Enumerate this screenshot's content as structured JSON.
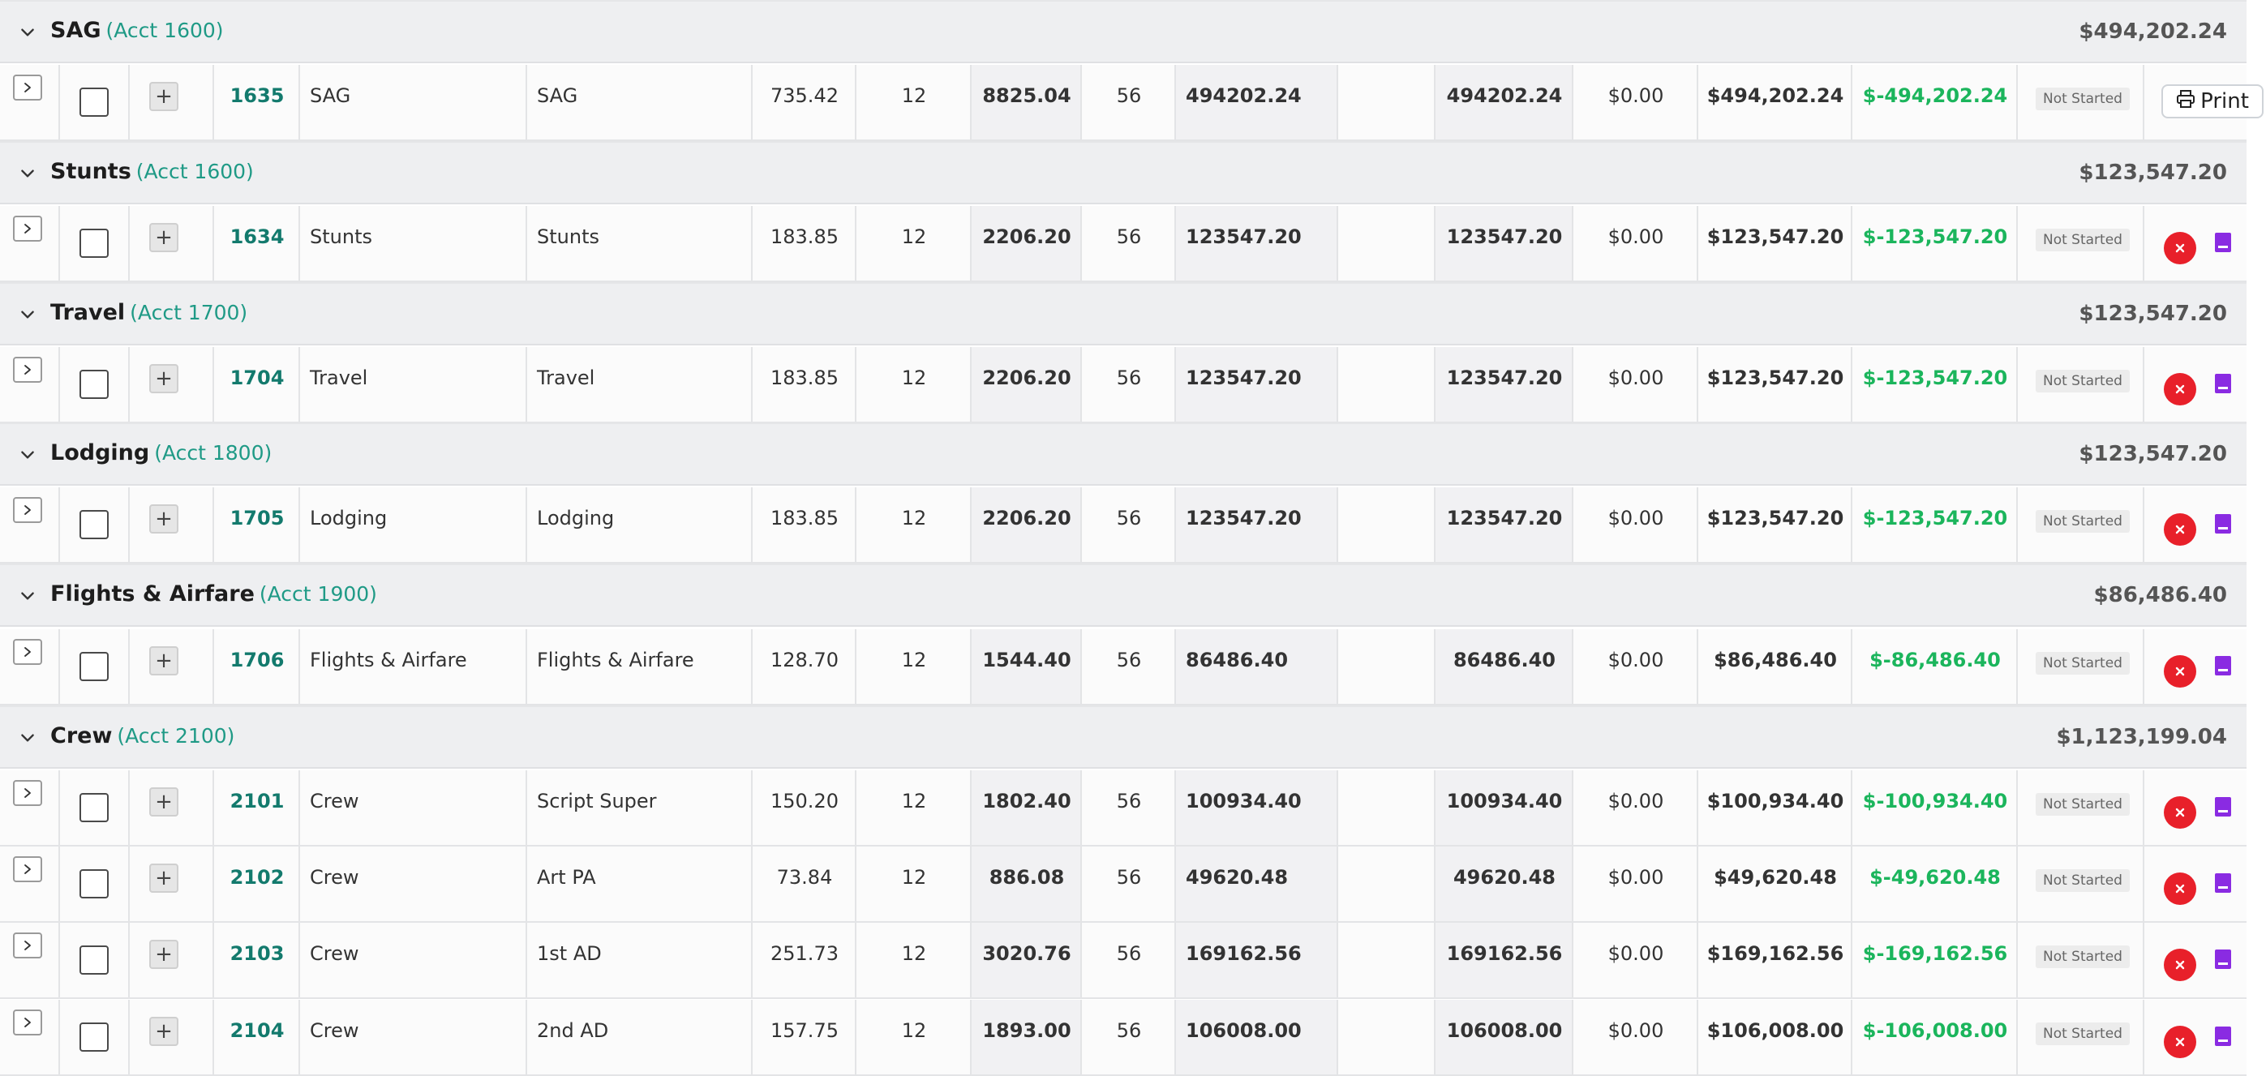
{
  "colors": {
    "accent_teal": "#1f9a86",
    "account_link": "#137a6d",
    "variance_green": "#1bb55c",
    "delete_red": "#e8202a",
    "note_purple": "#8a2be2",
    "group_bg": "#eeeff1"
  },
  "icons": {
    "group_toggle": "chevron-down-icon",
    "row_expand": "chevron-right-icon",
    "add": "plus-icon",
    "delete": "close-icon",
    "note": "note-icon",
    "print": "printer-icon"
  },
  "print_button": {
    "label": "Print"
  },
  "groups": [
    {
      "title": "SAG",
      "acct": "(Acct 1600)",
      "total": "$494,202.24",
      "rows": [
        {
          "acct": "1635",
          "category": "SAG",
          "description": "SAG",
          "rate": "735.42",
          "units": "12",
          "subtotal": "8825.04",
          "qty": "56",
          "total": "494202.24",
          "fringe": "",
          "estimate": "494202.24",
          "actual": "$0.00",
          "budget": "$494,202.24",
          "variance": "$-494,202.24",
          "status": "Not Started",
          "print": true
        }
      ]
    },
    {
      "title": "Stunts",
      "acct": "(Acct 1600)",
      "total": "$123,547.20",
      "rows": [
        {
          "acct": "1634",
          "category": "Stunts",
          "description": "Stunts",
          "rate": "183.85",
          "units": "12",
          "subtotal": "2206.20",
          "qty": "56",
          "total": "123547.20",
          "fringe": "",
          "estimate": "123547.20",
          "actual": "$0.00",
          "budget": "$123,547.20",
          "variance": "$-123,547.20",
          "status": "Not Started"
        }
      ]
    },
    {
      "title": "Travel",
      "acct": "(Acct 1700)",
      "total": "$123,547.20",
      "rows": [
        {
          "acct": "1704",
          "category": "Travel",
          "description": "Travel",
          "rate": "183.85",
          "units": "12",
          "subtotal": "2206.20",
          "qty": "56",
          "total": "123547.20",
          "fringe": "",
          "estimate": "123547.20",
          "actual": "$0.00",
          "budget": "$123,547.20",
          "variance": "$-123,547.20",
          "status": "Not Started"
        }
      ]
    },
    {
      "title": "Lodging",
      "acct": "(Acct 1800)",
      "total": "$123,547.20",
      "rows": [
        {
          "acct": "1705",
          "category": "Lodging",
          "description": "Lodging",
          "rate": "183.85",
          "units": "12",
          "subtotal": "2206.20",
          "qty": "56",
          "total": "123547.20",
          "fringe": "",
          "estimate": "123547.20",
          "actual": "$0.00",
          "budget": "$123,547.20",
          "variance": "$-123,547.20",
          "status": "Not Started"
        }
      ]
    },
    {
      "title": "Flights & Airfare",
      "acct": "(Acct 1900)",
      "total": "$86,486.40",
      "rows": [
        {
          "acct": "1706",
          "category": "Flights & Airfare",
          "description": "Flights & Airfare",
          "rate": "128.70",
          "units": "12",
          "subtotal": "1544.40",
          "qty": "56",
          "total": "86486.40",
          "fringe": "",
          "estimate": "86486.40",
          "actual": "$0.00",
          "budget": "$86,486.40",
          "variance": "$-86,486.40",
          "status": "Not Started"
        }
      ]
    },
    {
      "title": "Crew",
      "acct": "(Acct 2100)",
      "total": "$1,123,199.04",
      "rows": [
        {
          "acct": "2101",
          "category": "Crew",
          "description": "Script Super",
          "rate": "150.20",
          "units": "12",
          "subtotal": "1802.40",
          "qty": "56",
          "total": "100934.40",
          "fringe": "",
          "estimate": "100934.40",
          "actual": "$0.00",
          "budget": "$100,934.40",
          "variance": "$-100,934.40",
          "status": "Not Started"
        },
        {
          "acct": "2102",
          "category": "Crew",
          "description": "Art PA",
          "rate": "73.84",
          "units": "12",
          "subtotal": "886.08",
          "qty": "56",
          "total": "49620.48",
          "fringe": "",
          "estimate": "49620.48",
          "actual": "$0.00",
          "budget": "$49,620.48",
          "variance": "$-49,620.48",
          "status": "Not Started"
        },
        {
          "acct": "2103",
          "category": "Crew",
          "description": "1st AD",
          "rate": "251.73",
          "units": "12",
          "subtotal": "3020.76",
          "qty": "56",
          "total": "169162.56",
          "fringe": "",
          "estimate": "169162.56",
          "actual": "$0.00",
          "budget": "$169,162.56",
          "variance": "$-169,162.56",
          "status": "Not Started"
        },
        {
          "acct": "2104",
          "category": "Crew",
          "description": "2nd AD",
          "rate": "157.75",
          "units": "12",
          "subtotal": "1893.00",
          "qty": "56",
          "total": "106008.00",
          "fringe": "",
          "estimate": "106008.00",
          "actual": "$0.00",
          "budget": "$106,008.00",
          "variance": "$-106,008.00",
          "status": "Not Started"
        }
      ]
    }
  ]
}
